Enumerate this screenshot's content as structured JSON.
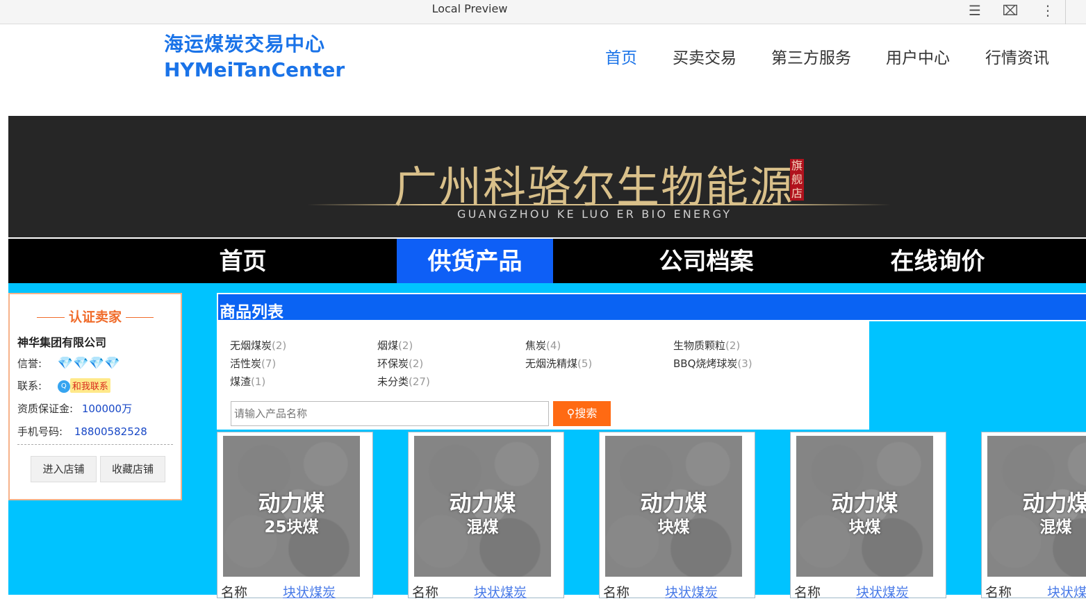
{
  "preview": {
    "title": "Local Preview",
    "icons": [
      "reader-icon",
      "code-icon",
      "more-icon"
    ]
  },
  "site": {
    "logo_cn": "海运煤炭交易中心",
    "logo_en": "HYMeiTanCenter"
  },
  "top_nav": [
    {
      "label": "首页",
      "active": true
    },
    {
      "label": "买卖交易",
      "active": false
    },
    {
      "label": "第三方服务",
      "active": false
    },
    {
      "label": "用户中心",
      "active": false
    },
    {
      "label": "行情资讯",
      "active": false
    }
  ],
  "banner": {
    "title": "广州科骆尔生物能源",
    "stamp": "旗舰店",
    "subtitle": "GUANGZHOU KE LUO ER BIO ENERGY"
  },
  "main_nav": [
    {
      "label": "首页",
      "active": false
    },
    {
      "label": "供货产品",
      "active": true
    },
    {
      "label": "公司档案",
      "active": false
    },
    {
      "label": "在线询价",
      "active": false
    }
  ],
  "seller": {
    "heading": "认证卖家",
    "company": "神华集团有限公司",
    "credit_label": "信誉:",
    "credit_gems": "💎💎💎💎",
    "contact_label": "联系:",
    "contact_badge": "和我联系",
    "deposit_label": "资质保证金:",
    "deposit_value": "100000万",
    "phone_label": "手机号码:",
    "phone_value": "18800582528",
    "enter_btn": "进入店铺",
    "fav_btn": "收藏店铺"
  },
  "goods": {
    "heading": "商品列表",
    "categories": [
      {
        "name": "无烟煤炭",
        "count": "(2)"
      },
      {
        "name": "烟煤",
        "count": "(2)"
      },
      {
        "name": "焦炭",
        "count": "(4)"
      },
      {
        "name": "生物质颗粒",
        "count": "(2)"
      },
      {
        "name": "活性炭",
        "count": "(7)"
      },
      {
        "name": "环保炭",
        "count": "(2)"
      },
      {
        "name": "无烟洗精煤",
        "count": "(5)"
      },
      {
        "name": "BBQ烧烤球炭",
        "count": "(3)"
      },
      {
        "name": "煤渣",
        "count": "(1)"
      },
      {
        "name": "未分类",
        "count": "(27)"
      }
    ],
    "search_placeholder": "请输入产品名称",
    "search_btn": "搜索",
    "products": [
      {
        "title1": "动力煤",
        "title2": "25块煤",
        "name_label": "名称",
        "name_value": "块状煤炭"
      },
      {
        "title1": "动力煤",
        "title2": "混煤",
        "name_label": "名称",
        "name_value": "块状煤炭"
      },
      {
        "title1": "动力煤",
        "title2": "块煤",
        "name_label": "名称",
        "name_value": "块状煤炭"
      },
      {
        "title1": "动力煤",
        "title2": "块煤",
        "name_label": "名称",
        "name_value": "块状煤炭"
      },
      {
        "title1": "动力煤",
        "title2": "混煤",
        "name_label": "名称",
        "name_value": "块状煤炭"
      }
    ]
  }
}
